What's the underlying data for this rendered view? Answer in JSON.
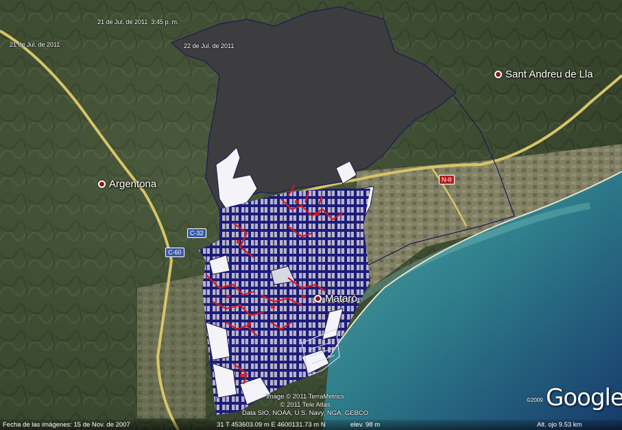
{
  "map": {
    "dates": {
      "date_1": "21 de Jul. de 2011",
      "time_1": "3:45 p. m.",
      "date_2": "21 de Jul. de 2011",
      "date_3": "22 de Jul. de 2011"
    },
    "places": {
      "sant_andreu": "Sant Andreu de Lla",
      "argentona": "Argentona",
      "mataro": "Mataró"
    },
    "roads": {
      "nii": "N-II",
      "c32": "C-32",
      "c60": "C-60"
    },
    "credits": {
      "line_1": "Image © 2011 TerraMetrics",
      "line_2": "© 2011 Tele Atlas",
      "line_3": "Data SIO, NOAA, U.S. Navy, NGA, GEBCO"
    },
    "logo": {
      "year": "©2009",
      "name": "Google"
    },
    "status": {
      "imagery_date": "Fecha de las imágenes: 15 de Nov. de 2007",
      "coordinates": "31 T 453603.09 m E 4600131.73 m N",
      "elevation": "elev.   98 m",
      "eye_alt": "Alt. ojo    9.53 km"
    },
    "colors": {
      "polygon_fill": "#3d3d3f",
      "street_blue": "#1a1a78",
      "street_red": "#d81818",
      "block_white": "#f4f4f8",
      "sea": "#3d8a8a"
    }
  }
}
